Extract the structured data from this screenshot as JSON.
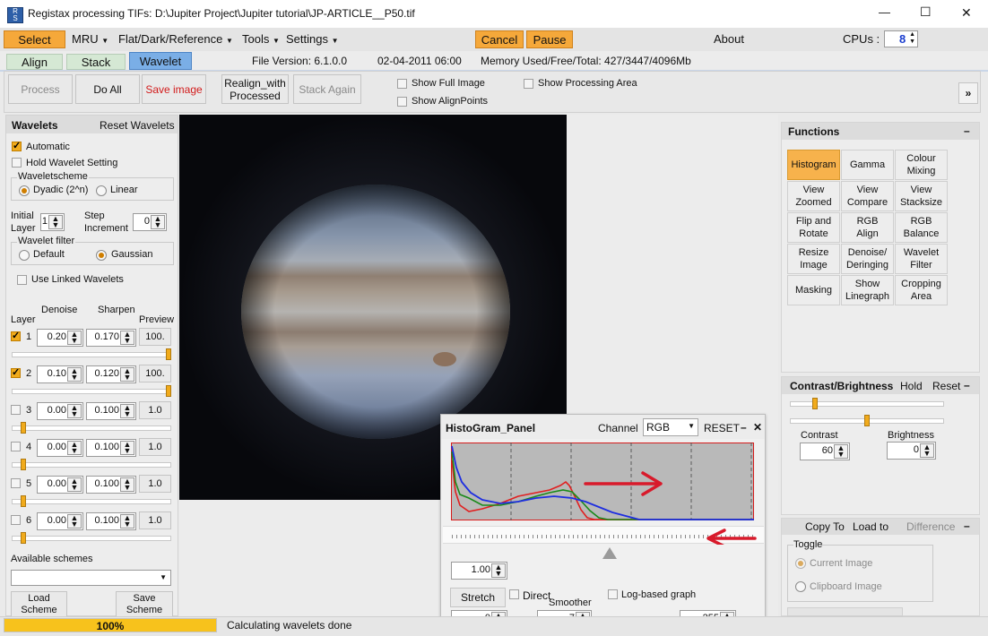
{
  "window": {
    "title": "Registax processing TIFs: D:\\Jupiter Project\\Jupiter tutorial\\JP-ARTICLE__P50.tif",
    "minimize": "—",
    "maximize": "☐",
    "close": "✕"
  },
  "menu": {
    "select": "Select",
    "mru": "MRU",
    "flat": "Flat/Dark/Reference",
    "tools": "Tools",
    "settings": "Settings",
    "cancel": "Cancel",
    "pause": "Pause",
    "about": "About",
    "cpus_label": "CPUs :",
    "cpus_value": "8"
  },
  "tabs": {
    "align": "Align",
    "stack": "Stack",
    "wavelet": "Wavelet"
  },
  "info": {
    "file_version": "File Version: 6.1.0.0",
    "date": "02-04-2011 06:00",
    "memory": "Memory Used/Free/Total: 427/3447/4096Mb"
  },
  "toolbar": {
    "process": "Process",
    "do_all": "Do All",
    "save_image": "Save image",
    "realign_1": "Realign_with",
    "realign_2": "Processed",
    "stack_again": "Stack Again",
    "show_full_image": "Show Full Image",
    "show_alignpoints": "Show AlignPoints",
    "show_processing_area": "Show Processing Area",
    "expand": "»"
  },
  "wavelets": {
    "title": "Wavelets",
    "reset": "Reset Wavelets",
    "automatic": "Automatic",
    "hold": "Hold Wavelet Setting",
    "scheme_label": "Waveletscheme",
    "dyadic": "Dyadic (2^n)",
    "linear": "Linear",
    "initial_1": "Initial",
    "initial_2": "Layer",
    "initial_value": "1",
    "step_1": "Step",
    "step_2": "Increment",
    "step_value": "0",
    "filter_label": "Wavelet filter",
    "default": "Default",
    "gaussian": "Gaussian",
    "linked": "Use Linked Wavelets",
    "col_layer": "Layer",
    "col_denoise": "Denoise",
    "col_sharpen": "Sharpen",
    "col_preview": "Preview",
    "layers": [
      {
        "n": "1",
        "denoise": "0.20",
        "sharpen": "0.170",
        "preview": "100.",
        "checked": true,
        "slider": 1.0
      },
      {
        "n": "2",
        "denoise": "0.10",
        "sharpen": "0.120",
        "preview": "100.",
        "checked": true,
        "slider": 1.0
      },
      {
        "n": "3",
        "denoise": "0.00",
        "sharpen": "0.100",
        "preview": "1.0",
        "checked": false,
        "slider": 0.0
      },
      {
        "n": "4",
        "denoise": "0.00",
        "sharpen": "0.100",
        "preview": "1.0",
        "checked": false,
        "slider": 0.0
      },
      {
        "n": "5",
        "denoise": "0.00",
        "sharpen": "0.100",
        "preview": "1.0",
        "checked": false,
        "slider": 0.0
      },
      {
        "n": "6",
        "denoise": "0.00",
        "sharpen": "0.100",
        "preview": "1.0",
        "checked": false,
        "slider": 0.0
      }
    ],
    "available": "Available schemes",
    "load_1": "Load",
    "load_2": "Scheme",
    "save_1": "Save",
    "save_2": "Scheme"
  },
  "functions": {
    "title": "Functions",
    "collapse": "–",
    "buttons": [
      [
        "Histogram"
      ],
      [
        "Gamma"
      ],
      [
        "Colour",
        "Mixing"
      ],
      [
        "View",
        "Zoomed"
      ],
      [
        "View",
        "Compare"
      ],
      [
        "View",
        "Stacksize"
      ],
      [
        "Flip and",
        "Rotate"
      ],
      [
        "RGB",
        "Align"
      ],
      [
        "RGB",
        "Balance"
      ],
      [
        "Resize",
        "Image"
      ],
      [
        "Denoise/",
        "Deringing"
      ],
      [
        "Wavelet",
        "Filter"
      ],
      [
        "Masking"
      ],
      [
        "Show",
        "Linegraph"
      ],
      [
        "Cropping",
        "Area"
      ]
    ]
  },
  "contrast": {
    "title": "Contrast/Brightness",
    "hold": "Hold",
    "reset": "Reset",
    "collapse": "–",
    "contrast_label": "Contrast",
    "contrast_value": "60",
    "brightness_label": "Brightness",
    "brightness_value": "0"
  },
  "copy": {
    "copy_to": "Copy To",
    "load_to": "Load to",
    "difference": "Difference",
    "collapse": "–",
    "toggle": "Toggle",
    "current": "Current Image",
    "clipboard": "Clipboard Image"
  },
  "histogram": {
    "title": "HistoGram_Panel",
    "channel_label": "Channel",
    "channel_value": "RGB",
    "reset": "RESET",
    "minimize": "–",
    "close": "✕",
    "gamma": "1.00",
    "stretch": "Stretch",
    "direct": "Direct",
    "smoother": "Smoother",
    "log_graph": "Log-based graph",
    "low": "0",
    "smooth_value": "7",
    "high": "255"
  },
  "status": {
    "progress": "100%",
    "progress_fraction": 1.0,
    "message": "Calculating wavelets done"
  },
  "colors": {
    "accent": "#f1ab1c",
    "tab_active": "#7aaee6",
    "annotation": "#d81a2b"
  }
}
